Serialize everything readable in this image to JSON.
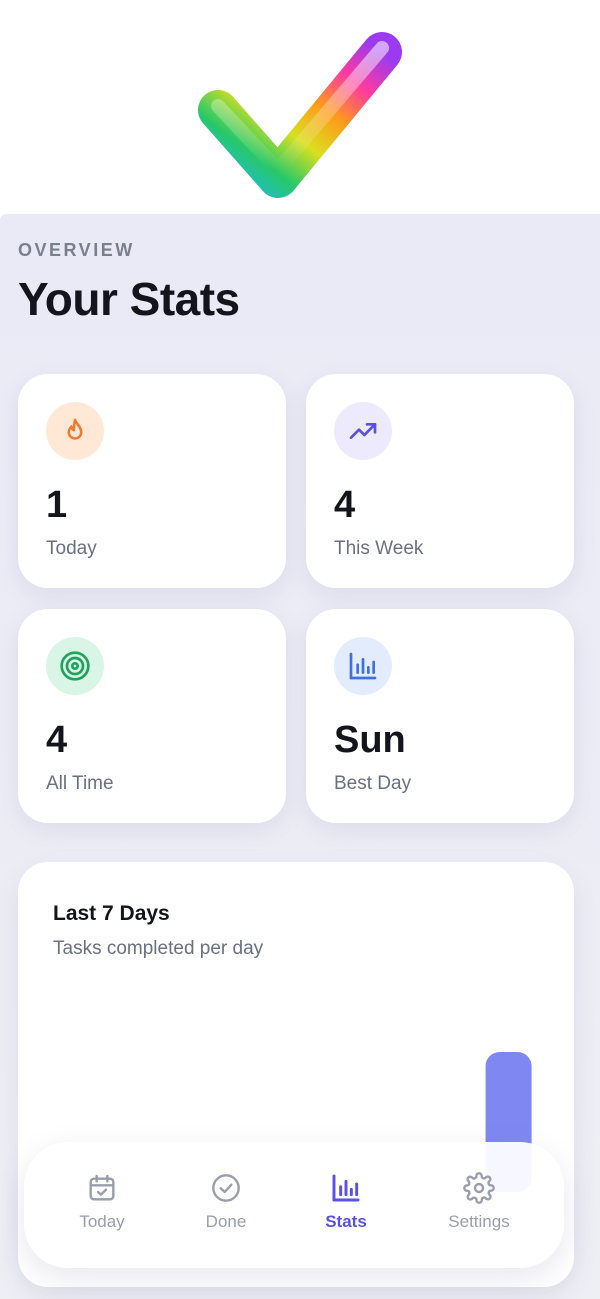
{
  "header": {
    "eyebrow": "OVERVIEW",
    "title": "Your Stats"
  },
  "stats": [
    {
      "value": "1",
      "label": "Today",
      "icon": "flame-icon",
      "color": "#f07a2e",
      "bg": "#ffe9d6"
    },
    {
      "value": "4",
      "label": "This Week",
      "icon": "trending-up-icon",
      "color": "#5b50e6",
      "bg": "#eeeafd"
    },
    {
      "value": "4",
      "label": "All Time",
      "icon": "target-icon",
      "color": "#1fa35c",
      "bg": "#d9f5e6"
    },
    {
      "value": "Sun",
      "label": "Best Day",
      "icon": "bar-chart-icon",
      "color": "#3f6fe0",
      "bg": "#e3ecfd"
    }
  ],
  "chart": {
    "title": "Last 7 Days",
    "subtitle": "Tasks completed per day"
  },
  "chart_data": {
    "type": "bar",
    "categories": [],
    "values": [
      0,
      0,
      0,
      0,
      0,
      0,
      4
    ],
    "title": "Last 7 Days",
    "subtitle": "Tasks completed per day",
    "bar_color": "#7f88f2",
    "ylim": [
      0,
      4
    ]
  },
  "nav": {
    "items": [
      {
        "label": "Today",
        "icon": "calendar-check-icon",
        "active": false
      },
      {
        "label": "Done",
        "icon": "check-circle-icon",
        "active": false
      },
      {
        "label": "Stats",
        "icon": "bar-chart-icon",
        "active": true
      },
      {
        "label": "Settings",
        "icon": "gear-icon",
        "active": false
      }
    ],
    "active_color": "#5b50e6",
    "inactive_color": "#9a9eab"
  }
}
